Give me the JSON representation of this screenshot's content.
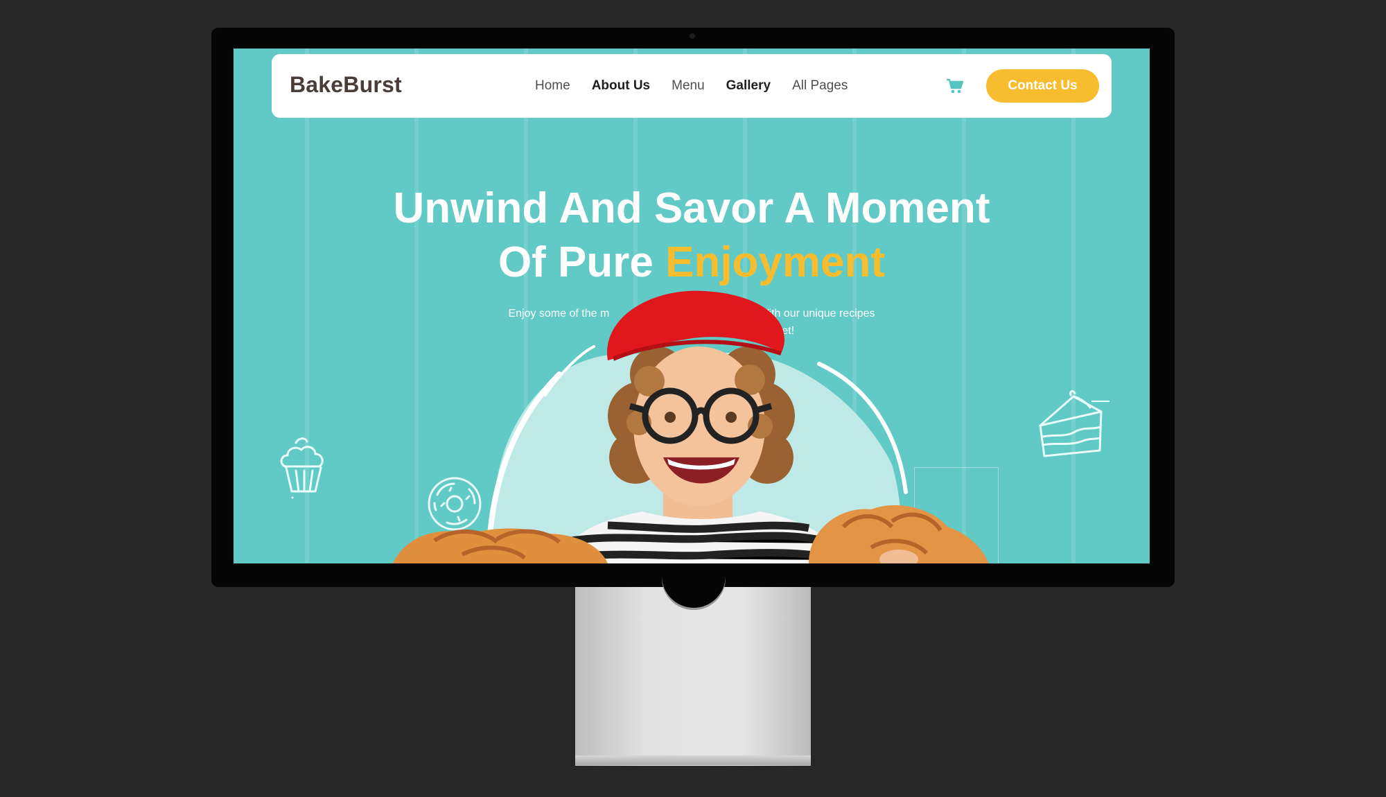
{
  "brand": {
    "name": "BakeBurst"
  },
  "nav": {
    "items": [
      {
        "label": "Home"
      },
      {
        "label": "About Us"
      },
      {
        "label": "Menu"
      },
      {
        "label": "Gallery"
      },
      {
        "label": "All Pages"
      }
    ],
    "contact_label": "Contact Us"
  },
  "hero": {
    "title_line1": "Unwind And Savor A Moment",
    "title_line2_prefix": "Of Pure ",
    "title_line2_accent": "Enjoyment",
    "subtitle_line1": "Enjoy some of the m                                    dishes. With our unique recipes",
    "subtitle_line2": "n't forget!"
  },
  "icons": [
    "cart-icon",
    "cupcake-icon",
    "donut-icon",
    "cake-slice-icon"
  ],
  "colors": {
    "background": "#272727",
    "hero_teal": "#61c9c6",
    "accent_yellow": "#f7bd2e",
    "logo_brown": "#4a3d38"
  }
}
